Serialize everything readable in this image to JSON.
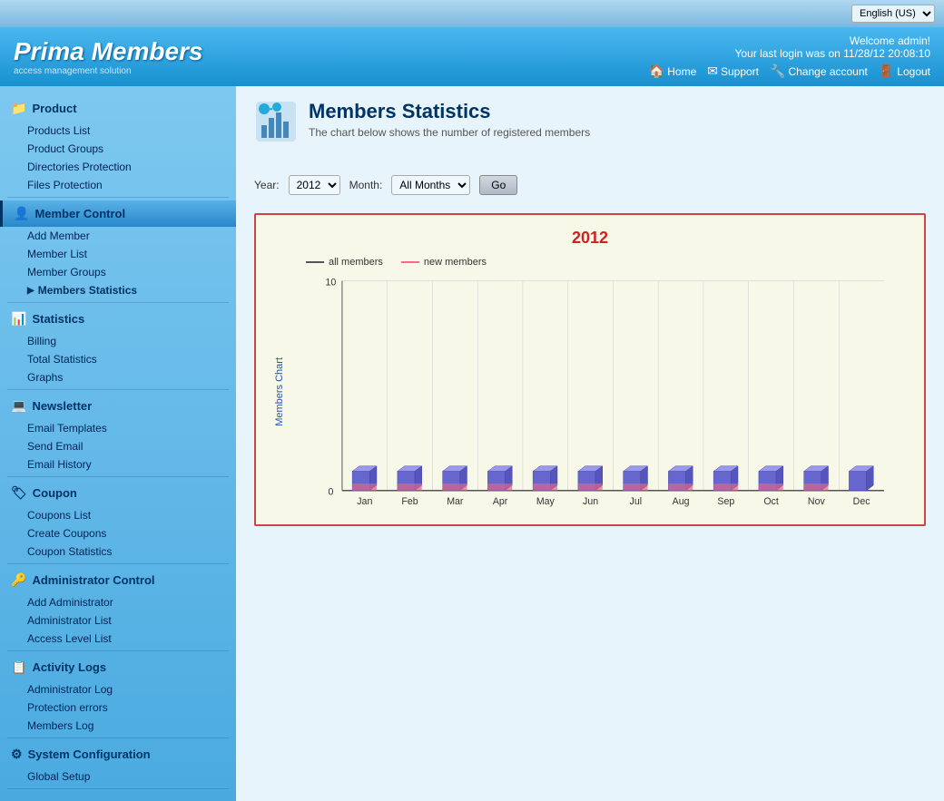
{
  "topbar": {
    "language": "English (US)"
  },
  "header": {
    "logo_title": "Prima Members",
    "logo_subtitle": "access management solution",
    "welcome": "Welcome admin!",
    "last_login": "Your last login was on 11/28/12 20:08:10",
    "nav": {
      "home": "Home",
      "support": "Support",
      "change_account": "Change account",
      "logout": "Logout"
    }
  },
  "sidebar": {
    "sections": [
      {
        "id": "product",
        "icon": "📁",
        "label": "Product",
        "active": false,
        "items": [
          {
            "label": "Products List",
            "active": false
          },
          {
            "label": "Product Groups",
            "active": false
          },
          {
            "label": "Directories Protection",
            "active": false
          },
          {
            "label": "Files Protection",
            "active": false
          }
        ]
      },
      {
        "id": "member-control",
        "icon": "👤",
        "label": "Member Control",
        "active": true,
        "items": [
          {
            "label": "Add Member",
            "active": false
          },
          {
            "label": "Member List",
            "active": false
          },
          {
            "label": "Member Groups",
            "active": false
          },
          {
            "label": "Members Statistics",
            "active": true
          }
        ]
      },
      {
        "id": "statistics",
        "icon": "📊",
        "label": "Statistics",
        "active": false,
        "items": [
          {
            "label": "Billing",
            "active": false
          },
          {
            "label": "Total Statistics",
            "active": false
          },
          {
            "label": "Graphs",
            "active": false
          }
        ]
      },
      {
        "id": "newsletter",
        "icon": "💻",
        "label": "Newsletter",
        "active": false,
        "items": [
          {
            "label": "Email Templates",
            "active": false
          },
          {
            "label": "Send Email",
            "active": false
          },
          {
            "label": "Email History",
            "active": false
          }
        ]
      },
      {
        "id": "coupon",
        "icon": "🏷",
        "label": "Coupon",
        "active": false,
        "items": [
          {
            "label": "Coupons List",
            "active": false
          },
          {
            "label": "Create Coupons",
            "active": false
          },
          {
            "label": "Coupon Statistics",
            "active": false
          }
        ]
      },
      {
        "id": "administrator-control",
        "icon": "🔑",
        "label": "Administrator Control",
        "active": false,
        "items": [
          {
            "label": "Add Administrator",
            "active": false
          },
          {
            "label": "Administrator List",
            "active": false
          },
          {
            "label": "Access Level List",
            "active": false
          }
        ]
      },
      {
        "id": "activity-logs",
        "icon": "📋",
        "label": "Activity Logs",
        "active": false,
        "items": [
          {
            "label": "Administrator Log",
            "active": false
          },
          {
            "label": "Protection errors",
            "active": false
          },
          {
            "label": "Members Log",
            "active": false
          }
        ]
      },
      {
        "id": "system-configuration",
        "icon": "⚙",
        "label": "System Configuration",
        "active": false,
        "items": [
          {
            "label": "Global Setup",
            "active": false
          }
        ]
      }
    ]
  },
  "content": {
    "page_title": "Members Statistics",
    "page_subtitle": "The chart below shows the number of registered members",
    "filter": {
      "year_label": "Year:",
      "year_value": "2012",
      "month_label": "Month:",
      "month_value": "All Months",
      "go_button": "Go"
    },
    "chart": {
      "title": "2012",
      "y_label": "Members Chart",
      "y_max": 10,
      "y_min": 0,
      "legend_all": "all members",
      "legend_new": "new members",
      "months": [
        "Jan",
        "Feb",
        "Mar",
        "Apr",
        "May",
        "Jun",
        "Jul",
        "Aug",
        "Sep",
        "Oct",
        "Nov",
        "Dec"
      ],
      "all_members": [
        1,
        1,
        1,
        1,
        1,
        1,
        1,
        1,
        1,
        1,
        1,
        1
      ],
      "new_members": [
        1,
        1,
        1,
        1,
        1,
        1,
        1,
        1,
        1,
        1,
        1,
        0
      ]
    }
  }
}
